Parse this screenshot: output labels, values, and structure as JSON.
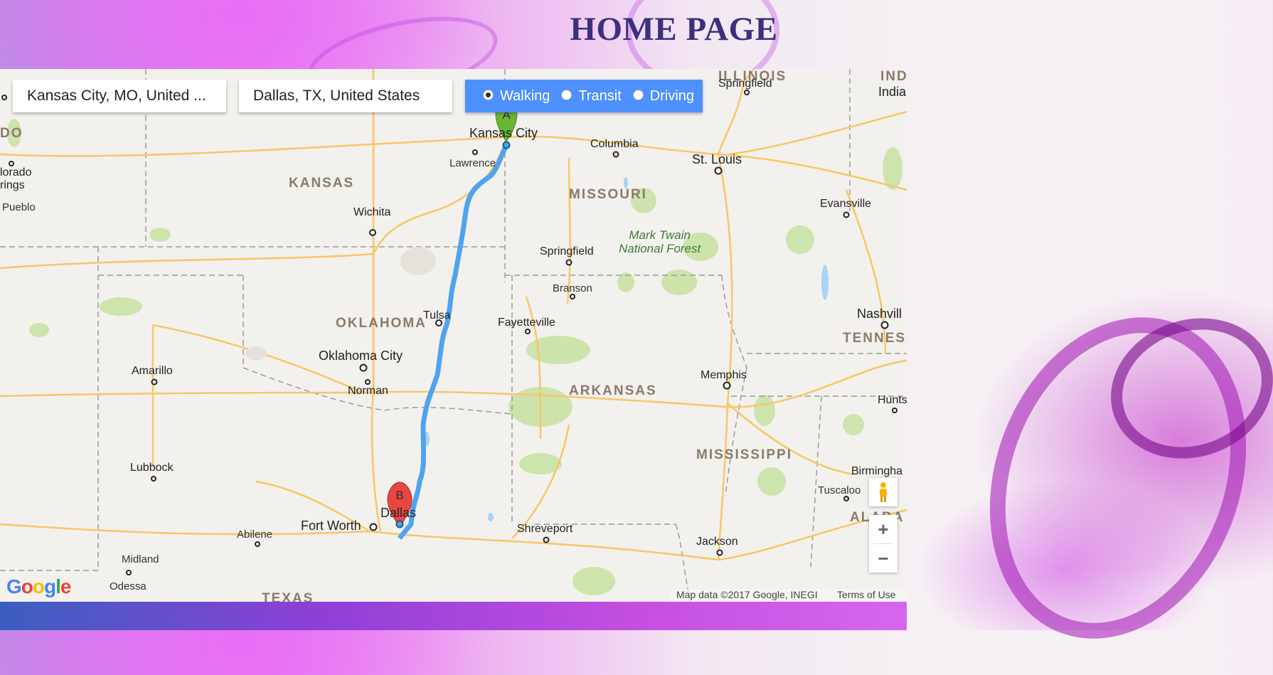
{
  "page": {
    "title": "HOME PAGE"
  },
  "directions": {
    "origin": "Kansas City, MO, United ...",
    "destination": "Dallas, TX, United States",
    "modes": [
      {
        "label": "Walking",
        "selected": true
      },
      {
        "label": "Transit",
        "selected": false
      },
      {
        "label": "Driving",
        "selected": false
      }
    ]
  },
  "map": {
    "states": {
      "kansas": "KANSAS",
      "missouri": "MISSOURI",
      "oklahoma": "OKLAHOMA",
      "arkansas": "ARKANSAS",
      "mississippi": "MISSISSIPPI",
      "texas": "TEXAS",
      "tennessee": "TENNES",
      "illinois": "ILLINOIS",
      "indiana_abbr": "IND",
      "alabama": "ALABA",
      "colorado": "DO"
    },
    "cities": {
      "kansas_city": "Kansas City",
      "columbia": "Columbia",
      "st_louis": "St. Louis",
      "springfield_il": "Springfield",
      "indiana": "India",
      "lawrence": "Lawrence",
      "wichita": "Wichita",
      "springfield_mo": "Springfield",
      "branson": "Branson",
      "evansville": "Evansville",
      "tulsa": "Tulsa",
      "fayetteville": "Fayetteville",
      "nashville": "Nashvill",
      "oklahoma_city": "Oklahoma City",
      "norman": "Norman",
      "amarillo": "Amarillo",
      "memphis": "Memphis",
      "huntsville": "Huntsv",
      "lubbock": "Lubbock",
      "dallas": "Dallas",
      "fort_worth": "Fort Worth",
      "abilene": "Abilene",
      "shreveport": "Shreveport",
      "jackson": "Jackson",
      "birmingham": "Birmingha",
      "tuscaloosa": "Tuscaloo",
      "midland": "Midland",
      "odessa": "Odessa",
      "pueblo": "Pueblo",
      "colorado_springs_1": "lorado",
      "colorado_springs_2": "rings"
    },
    "forest": {
      "line1": "Mark Twain",
      "line2": "National Forest"
    },
    "markers": {
      "start": "A",
      "end": "B"
    },
    "footer": {
      "logo": "Google",
      "attribution": "Map data ©2017 Google, INEGI",
      "terms": "Terms of Use"
    },
    "controls": {
      "zoom_in": "+",
      "zoom_out": "−"
    }
  },
  "colors": {
    "route": "#4fa3f0",
    "mode_panel": "#4d90fe",
    "title": "#3c2f7e",
    "marker_start": "#6bb535",
    "marker_end": "#e8473f"
  }
}
